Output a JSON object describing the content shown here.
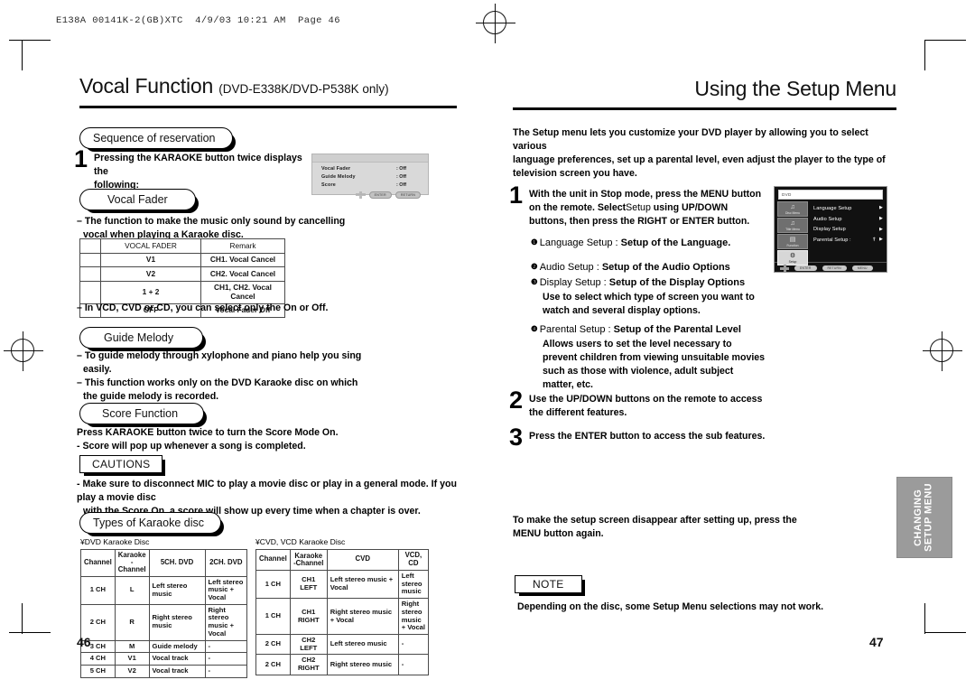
{
  "print_stamp": "E138A 00141K-2(GB)XTC  4/9/03 10:21 AM  Page 46",
  "left_page": {
    "title": "Vocal Function",
    "title_sub": "(DVD-E338K/DVD-P538K only)",
    "page_number": "46",
    "heading_sequence": "Sequence of reservation",
    "step1_num": "1",
    "step1_line1": "Pressing the KARAOKE button twice displays the",
    "step1_line2": "following:",
    "osd_karaoke": {
      "rows": [
        {
          "label": "Vocal  Fader",
          "value": ": Off"
        },
        {
          "label": "Guide  Melody",
          "value": ": Off"
        },
        {
          "label": "Score",
          "value": ": Off"
        }
      ],
      "buttons": [
        "ENTER",
        "RETURN"
      ]
    },
    "heading_vocal_fader": "Vocal Fader",
    "vf_desc_line1": "– The function to make the music only sound by cancelling",
    "vf_desc_line2": "vocal when playing a Karaoke disc.",
    "vf_table": {
      "headers": [
        "",
        "VOCAL FADER",
        "Remark"
      ],
      "rows": [
        [
          "",
          "V1",
          "CH1. Vocal Cancel"
        ],
        [
          "",
          "V2",
          "CH2. Vocal Cancel"
        ],
        [
          "",
          "1 + 2",
          "CH1, CH2. Vocal Cancel"
        ],
        [
          "",
          "OFF",
          "Vocal Fader Off"
        ]
      ]
    },
    "vf_note": "– In VCD, CVD or CD, you can select only the On or Off.",
    "heading_guide_melody": "Guide Melody",
    "gm_line1": "– To guide melody through xylophone and piano help you sing",
    "gm_line2": "easily.",
    "gm_line3": "– This function works only on the DVD Karaoke disc on which",
    "gm_line4": "the guide melody is recorded.",
    "heading_score_function": "Score Function",
    "sf_line1": "Press KARAOKE button twice to turn the Score Mode On.",
    "sf_line2": "- Score will pop up whenever a song is completed.",
    "cautions_label": "CAUTIONS",
    "cautions_line1": "- Make sure to disconnect MIC to play a movie disc or play in a general mode.  If you play a movie disc",
    "cautions_line2": "with the Score On, a score will show up every time when a chapter is over.",
    "heading_types": "Types of Karaoke disc",
    "dvd_table_caption": "¥DVD Karaoke Disc",
    "dvd_table": {
      "headers": [
        "Channel",
        "Karaoke -Channel",
        "5CH. DVD",
        "2CH. DVD"
      ],
      "rows": [
        [
          "1 CH",
          "L",
          "Left stereo music",
          "Left stereo music + Vocal"
        ],
        [
          "2 CH",
          "R",
          "Right stereo music",
          "Right stereo music + Vocal"
        ],
        [
          "3 CH",
          "M",
          "Guide melody",
          "-"
        ],
        [
          "4 CH",
          "V1",
          "Vocal track",
          "-"
        ],
        [
          "5 CH",
          "V2",
          "Vocal track",
          "-"
        ]
      ]
    },
    "cvd_table_caption": "¥CVD, VCD Karaoke Disc",
    "cvd_table": {
      "headers": [
        "Channel",
        "Karaoke -Channel",
        "CVD",
        "VCD, CD"
      ],
      "rows": [
        [
          "1 CH",
          "CH1 LEFT",
          "Left stereo music + Vocal",
          "Left stereo music"
        ],
        [
          "1 CH",
          "CH1 RIGHT",
          "Right stereo music + Vocal",
          "Right stereo music + Vocal"
        ],
        [
          "2 CH",
          "CH2 LEFT",
          "Left stereo music",
          "-"
        ],
        [
          "2 CH",
          "CH2 RIGHT",
          "Right stereo music",
          "-"
        ]
      ]
    }
  },
  "right_page": {
    "title": "Using the Setup Menu",
    "page_number": "47",
    "intro_line1": "The Setup menu lets you customize your DVD player by allowing you to select various",
    "intro_line2": "language preferences, set up a parental level, even adjust the player to the type of",
    "intro_line3": "television screen you have.",
    "step1_num": "1",
    "step1_line1": "With the unit in Stop mode, press the MENU button",
    "step1_line2a": "on the remote. Select",
    "step1_line2b": "Setup",
    "step1_line2c": " using UP/DOWN",
    "step1_line3": "buttons, then press the RIGHT or ENTER button.",
    "options": [
      {
        "num": "❶",
        "name": "Language Setup : ",
        "desc": "Setup of the Language."
      },
      {
        "num": "❷",
        "name": "Audio Setup : ",
        "desc": "Setup of the Audio Options"
      },
      {
        "num": "❸",
        "name": "Display Setup : ",
        "desc": "Setup of the Display Options"
      },
      {
        "num": "❹",
        "name": "Parental Setup : ",
        "desc": "Setup of the Parental Level"
      }
    ],
    "display_extra_line1": "Use to select which type of screen you want to",
    "display_extra_line2": "watch and several display options.",
    "parental_extra_line1": "Allows users to set the level necessary to",
    "parental_extra_line2": "prevent children from viewing unsuitable movies",
    "parental_extra_line3": "such as those with violence, adult subject",
    "parental_extra_line4": "matter, etc.",
    "step2_num": "2",
    "step2_line1": "Use the UP/DOWN buttons on the remote to access",
    "step2_line2": "the different features.",
    "step3_num": "3",
    "step3_line1": "Press the ENTER button to access the sub features.",
    "closing_line1": "To make the setup screen disappear after setting up, press the",
    "closing_line2": "MENU button again.",
    "note_label": "NOTE",
    "note_text": "Depending on the disc, some Setup Menu selections may not work.",
    "side_tab": "CHANGING\nSETUP MENU",
    "osd_setup": {
      "title": "DVD",
      "sidebar": [
        {
          "label": "Disc Menu",
          "glyph": "♪"
        },
        {
          "label": "Title Menu",
          "glyph": "♪"
        },
        {
          "label": "Function",
          "glyph": "▤"
        },
        {
          "label": "Setup",
          "glyph": "⚙"
        }
      ],
      "items": [
        {
          "label": "Language Setup",
          "arrow": "▶"
        },
        {
          "label": "Audio Setup",
          "arrow": "▶"
        },
        {
          "label": "Display Setup",
          "arrow": "▶"
        },
        {
          "label": "Parental Setup :",
          "arrow": "▶"
        }
      ],
      "footer_buttons": [
        "ENTER",
        "RETURN",
        "MENU"
      ]
    }
  }
}
